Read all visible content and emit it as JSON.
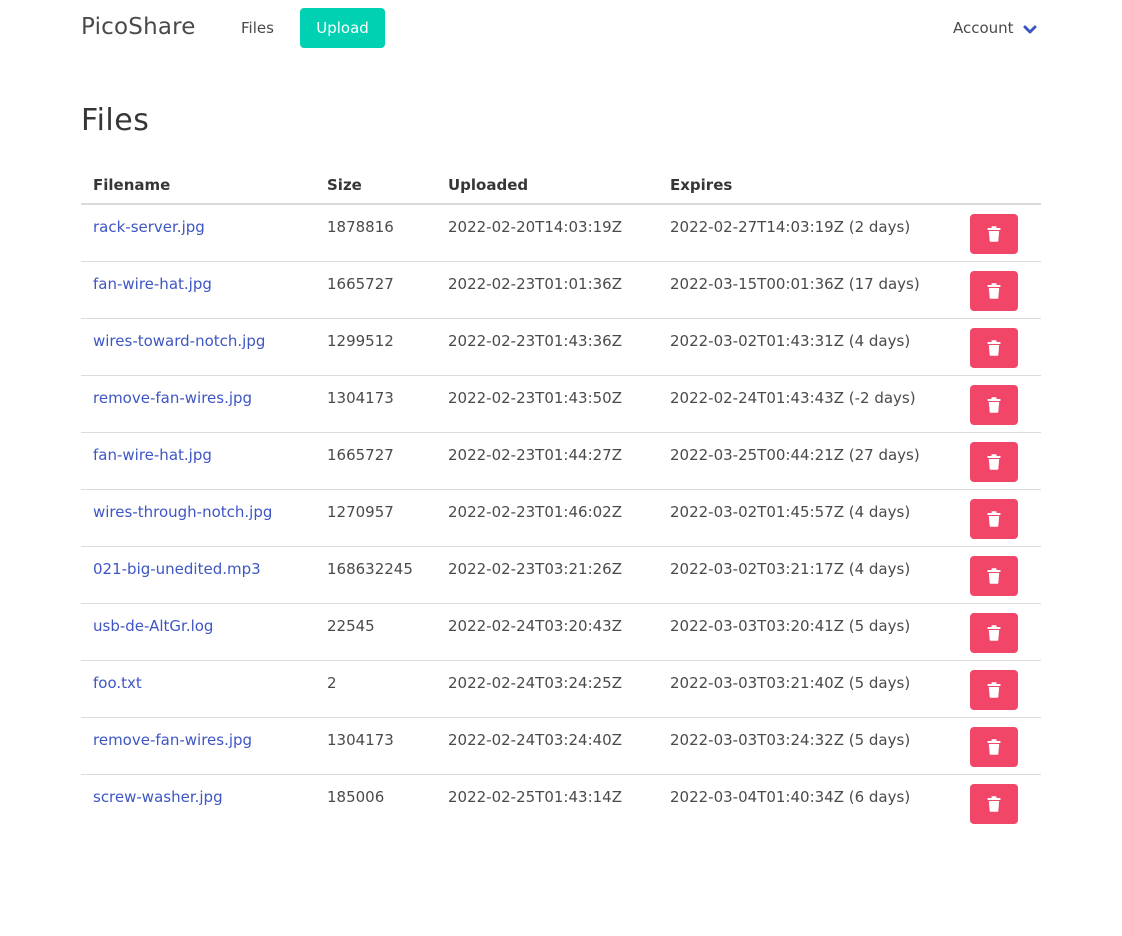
{
  "navbar": {
    "brand": "PicoShare",
    "files_label": "Files",
    "upload_label": "Upload",
    "account_label": "Account",
    "upload_color": "#00d1b2"
  },
  "page": {
    "title": "Files"
  },
  "table": {
    "headers": {
      "filename": "Filename",
      "size": "Size",
      "uploaded": "Uploaded",
      "expires": "Expires"
    },
    "delete_icon": "trash-icon",
    "delete_color": "#f14668",
    "rows": [
      {
        "filename": "rack-server.jpg",
        "size": "1878816",
        "uploaded": "2022-02-20T14:03:19Z",
        "expires": "2022-02-27T14:03:19Z (2 days)"
      },
      {
        "filename": "fan-wire-hat.jpg",
        "size": "1665727",
        "uploaded": "2022-02-23T01:01:36Z",
        "expires": "2022-03-15T00:01:36Z (17 days)"
      },
      {
        "filename": "wires-toward-notch.jpg",
        "size": "1299512",
        "uploaded": "2022-02-23T01:43:36Z",
        "expires": "2022-03-02T01:43:31Z (4 days)"
      },
      {
        "filename": "remove-fan-wires.jpg",
        "size": "1304173",
        "uploaded": "2022-02-23T01:43:50Z",
        "expires": "2022-02-24T01:43:43Z (-2 days)"
      },
      {
        "filename": "fan-wire-hat.jpg",
        "size": "1665727",
        "uploaded": "2022-02-23T01:44:27Z",
        "expires": "2022-03-25T00:44:21Z (27 days)"
      },
      {
        "filename": "wires-through-notch.jpg",
        "size": "1270957",
        "uploaded": "2022-02-23T01:46:02Z",
        "expires": "2022-03-02T01:45:57Z (4 days)"
      },
      {
        "filename": "021-big-unedited.mp3",
        "size": "168632245",
        "uploaded": "2022-02-23T03:21:26Z",
        "expires": "2022-03-02T03:21:17Z (4 days)"
      },
      {
        "filename": "usb-de-AltGr.log",
        "size": "22545",
        "uploaded": "2022-02-24T03:20:43Z",
        "expires": "2022-03-03T03:20:41Z (5 days)"
      },
      {
        "filename": "foo.txt",
        "size": "2",
        "uploaded": "2022-02-24T03:24:25Z",
        "expires": "2022-03-03T03:21:40Z (5 days)"
      },
      {
        "filename": "remove-fan-wires.jpg",
        "size": "1304173",
        "uploaded": "2022-02-24T03:24:40Z",
        "expires": "2022-03-03T03:24:32Z (5 days)"
      },
      {
        "filename": "screw-washer.jpg",
        "size": "185006",
        "uploaded": "2022-02-25T01:43:14Z",
        "expires": "2022-03-04T01:40:34Z (6 days)"
      }
    ]
  }
}
